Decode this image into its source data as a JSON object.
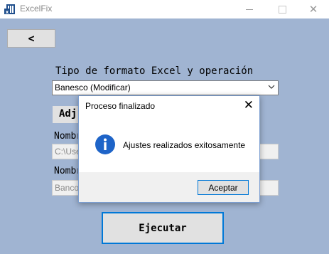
{
  "window": {
    "title": "ExcelFix",
    "minimize_icon": "minimize-icon",
    "maximize_icon": "maximize-icon",
    "close_glyph": "✕"
  },
  "main": {
    "back_label": "<",
    "format_label": "Tipo de formato Excel y operación",
    "format_selected": "Banesco (Modificar)",
    "adjust_label": "Adj",
    "name_label_1": "Nombr",
    "path_value_1": "C:\\Use",
    "name_label_2": "Nombr",
    "path_value_2": "Banco",
    "run_label": "Ejecutar"
  },
  "dialog": {
    "title": "Proceso finalizado",
    "close_glyph": "✕",
    "message": "Ajustes realizados exitosamente",
    "ok_label": "Aceptar",
    "icon": "info-icon"
  },
  "colors": {
    "background": "#a0b4d2",
    "accent": "#0078d7",
    "button": "#e1e1e1"
  }
}
